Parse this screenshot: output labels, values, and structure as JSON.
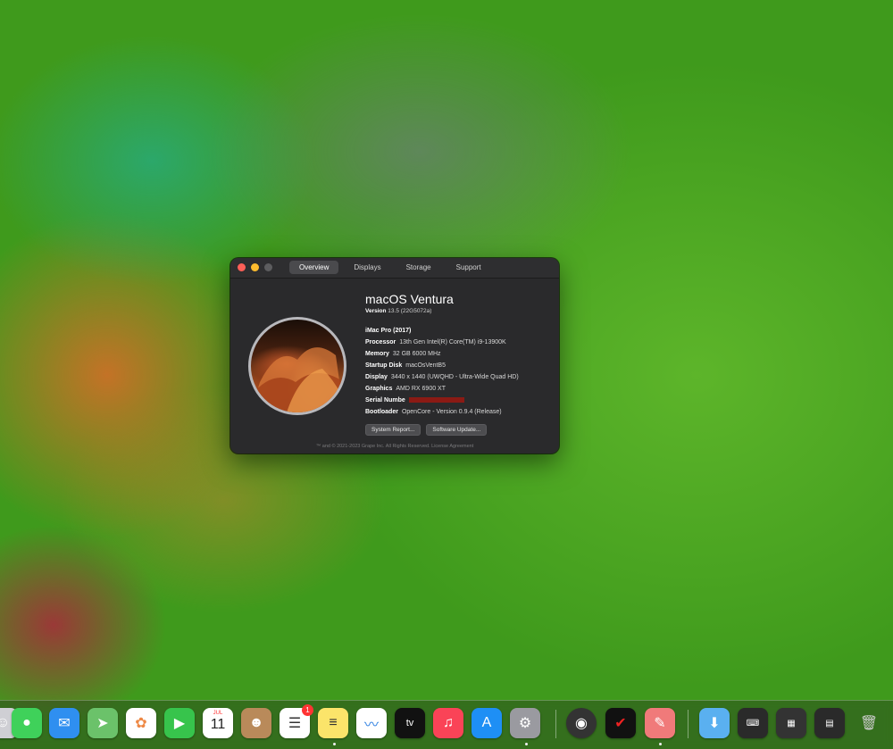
{
  "window": {
    "tabs": [
      {
        "label": "Overview",
        "active": true
      },
      {
        "label": "Displays",
        "active": false
      },
      {
        "label": "Storage",
        "active": false
      },
      {
        "label": "Support",
        "active": false
      }
    ],
    "os_name": "macOS Ventura",
    "version_label": "Version",
    "version_value": "13.5 (22G5072a)",
    "model": "iMac Pro (2017)",
    "specs": [
      {
        "key": "Processor",
        "value": "13th Gen Intel(R) Core(TM) i9-13900K"
      },
      {
        "key": "Memory",
        "value": "32 GB 6000 MHz"
      },
      {
        "key": "Startup Disk",
        "value": "macOsVentB5"
      },
      {
        "key": "Display",
        "value": "3440 x 1440 (UWQHD - Ultra-Wide Quad HD)"
      },
      {
        "key": "Graphics",
        "value": "AMD RX 6900 XT"
      },
      {
        "key": "Serial Numbe",
        "value": ""
      },
      {
        "key": "Bootloader",
        "value": "OpenCore - Version  0.9.4 (Release)"
      }
    ],
    "buttons": {
      "system_report": "System Report...",
      "software_update": "Software Update..."
    },
    "footer": "™ and © 2021-2023 Grape Inc. All Rights Reserved. License Agreement"
  },
  "dock": {
    "calendar_month": "JUL",
    "calendar_day": "11",
    "reminders_badge": "1",
    "tv_label": "tv"
  },
  "colors": {
    "window_bg": "#2a2a2c",
    "close": "#fe5f57",
    "minimize": "#febc2e",
    "redaction": "#8b1a14"
  }
}
